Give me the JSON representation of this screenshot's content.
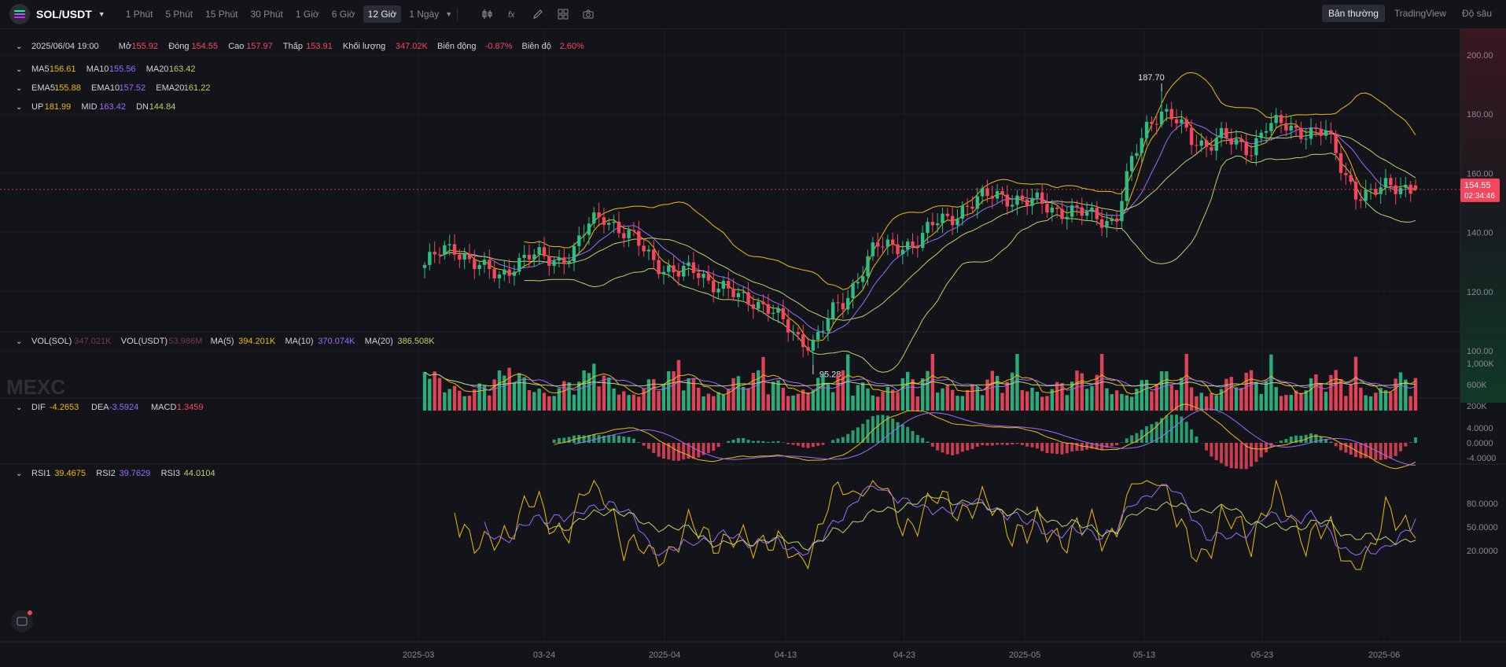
{
  "toolbar": {
    "symbol": "SOL/USDT",
    "intervals": [
      "1 Phút",
      "5 Phút",
      "15 Phút",
      "30 Phút",
      "1 Giờ",
      "6 Giờ",
      "12 Giờ",
      "1 Ngày"
    ],
    "active_interval": "12 Giờ",
    "views": [
      "Bản thường",
      "TradingView",
      "Độ sâu"
    ],
    "active_view": "Bản thường"
  },
  "colors": {
    "up": "#2ebd85",
    "down": "#f6465d",
    "ma5": "#f0b90b",
    "ma10": "#9b6cff",
    "ma20": "#b8d36a",
    "bg": "#131419"
  },
  "legend": {
    "ohlc": [
      {
        "label": "2025/06/04 19:00",
        "value": ""
      },
      {
        "label": "Mở",
        "value": "155.92"
      },
      {
        "label": "Đóng",
        "value": "154.55"
      },
      {
        "label": "Cao",
        "value": "157.97"
      },
      {
        "label": "Thấp",
        "value": "153.91"
      },
      {
        "label": "Khối lượng",
        "value": "347.02K"
      },
      {
        "label": "Biến động",
        "value": "-0.87%"
      },
      {
        "label": "Biên độ",
        "value": "2.60%"
      }
    ],
    "ma": [
      {
        "label": "MA5",
        "value": "156.61"
      },
      {
        "label": "MA10",
        "value": "155.56"
      },
      {
        "label": "MA20",
        "value": "163.42"
      }
    ],
    "ema": [
      {
        "label": "EMA5",
        "value": "155.88"
      },
      {
        "label": "EMA10",
        "value": "157.52"
      },
      {
        "label": "EMA20",
        "value": "161.22"
      }
    ],
    "boll": [
      {
        "label": "UP",
        "value": "181.99"
      },
      {
        "label": "MID",
        "value": "163.42"
      },
      {
        "label": "DN",
        "value": "144.84"
      }
    ],
    "vol": [
      {
        "label": "VOL(SOL)",
        "value": "347.021K"
      },
      {
        "label": "VOL(USDT)",
        "value": "53.986M"
      },
      {
        "label": "MA(5)",
        "value": "394.201K"
      },
      {
        "label": "MA(10)",
        "value": "370.074K"
      },
      {
        "label": "MA(20)",
        "value": "386.508K"
      }
    ],
    "macd": [
      {
        "label": "DIF",
        "value": "-4.2653"
      },
      {
        "label": "DEA",
        "value": "-3.5924"
      },
      {
        "label": "MACD",
        "value": "-1.3459"
      }
    ],
    "rsi": [
      {
        "label": "RSI1",
        "value": "39.4675"
      },
      {
        "label": "RSI2",
        "value": "39.7629"
      },
      {
        "label": "RSI3",
        "value": "44.0104"
      }
    ]
  },
  "price_axis": {
    "ticks": [
      "200.00",
      "180.00",
      "160.00",
      "140.00",
      "120.00",
      "100.00"
    ],
    "current_price": "154.55",
    "countdown": "02:34:46"
  },
  "vol_axis": {
    "ticks": [
      "1,000K",
      "600K",
      "200K"
    ]
  },
  "macd_axis": {
    "ticks": [
      "4.0000",
      "0.0000",
      "-4.0000"
    ]
  },
  "rsi_axis": {
    "ticks": [
      "80.0000",
      "50.0000",
      "20.0000"
    ]
  },
  "time_axis": {
    "ticks": [
      "2025-03",
      "03-24",
      "2025-04",
      "04-13",
      "04-23",
      "2025-05",
      "05-13",
      "05-23",
      "2025-06"
    ]
  },
  "annotations": {
    "high": "187.70",
    "low": "95.28"
  },
  "watermark": "MEXC",
  "chart_data": {
    "type": "candlestick",
    "interval": "12h",
    "ylim": [
      90,
      205
    ],
    "high": 187.7,
    "low": 95.28,
    "last": {
      "open": 155.92,
      "close": 154.55,
      "high": 157.97,
      "low": 153.91
    },
    "close_path": [
      129,
      133,
      135,
      131,
      127,
      125,
      130,
      132,
      131,
      131,
      134,
      143,
      146,
      141,
      137,
      132,
      128,
      126,
      127,
      124,
      121,
      117,
      117,
      115,
      108,
      103,
      104,
      112,
      116,
      127,
      136,
      134,
      136,
      138,
      143,
      145,
      149,
      151,
      153,
      152,
      150,
      150,
      148,
      147,
      146,
      145,
      144,
      162,
      175,
      182,
      178,
      171,
      170,
      173,
      169,
      168,
      177,
      176,
      174,
      175,
      174,
      162,
      154,
      153,
      155,
      156,
      155
    ]
  }
}
